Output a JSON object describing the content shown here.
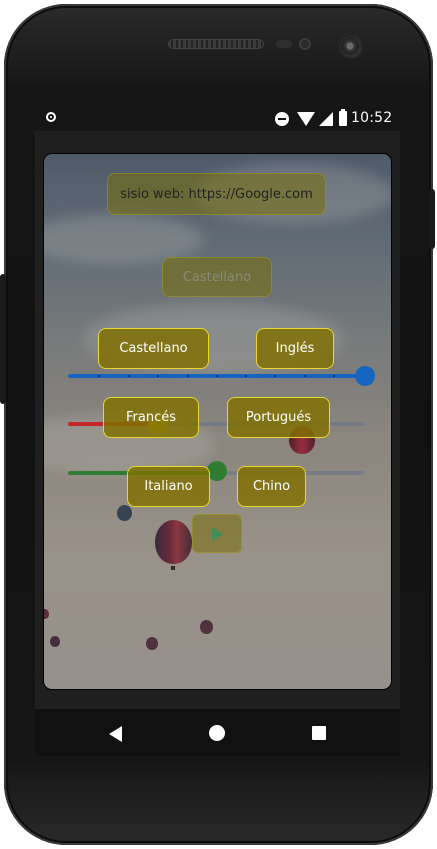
{
  "status_bar": {
    "time": "10:52",
    "icons": [
      "notification-dot-icon",
      "dnd-icon",
      "wifi-icon",
      "signal-icon",
      "battery-icon"
    ]
  },
  "app": {
    "website_button": "sisio web: https://Google.com",
    "selected_language_button": "Castellano",
    "languages": {
      "castellano": "Castellano",
      "ingles": "Inglés",
      "frances": "Francés",
      "portugues": "Portugués",
      "italiano": "Italiano",
      "chino": "Chino"
    },
    "sliders": [
      {
        "name": "blue-slider",
        "color": "#1565c0",
        "value": 1.0
      },
      {
        "name": "red-slider",
        "color": "#c62828",
        "value": 0.3
      },
      {
        "name": "green-slider",
        "color": "#2e7d32",
        "value": 0.5
      }
    ],
    "play_icon": "play-icon"
  },
  "colors": {
    "button_fill": "#807000",
    "button_border": "#e8d830",
    "button_text": "#ffffff"
  },
  "nav_bar": {
    "icons": [
      "back-icon",
      "home-icon",
      "recents-icon"
    ]
  }
}
